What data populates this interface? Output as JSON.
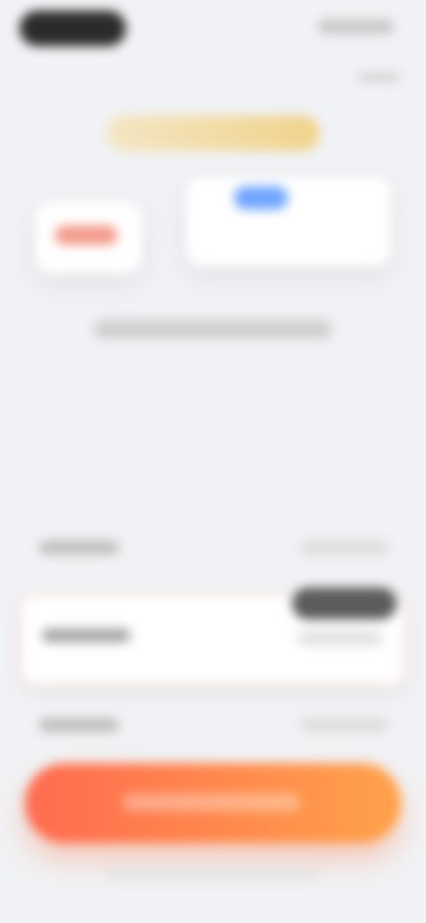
{
  "status": {
    "time": "",
    "icons": ""
  },
  "header": {
    "top_link": ""
  },
  "hero": {
    "badge_text": "",
    "card_primary_title": "",
    "card_secondary_title": ""
  },
  "subtitle": "",
  "headline": {
    "line1_prefix": "",
    "line1_accent": "",
    "line1_suffix": "",
    "line2": "",
    "line3_prefix": "",
    "line3_accent": ""
  },
  "plans": [
    {
      "label": "",
      "value": ""
    },
    {
      "label": "",
      "value": "",
      "badge": ""
    },
    {
      "label": "",
      "value": ""
    }
  ],
  "cta": {
    "label": ""
  },
  "footer": {
    "note": ""
  },
  "colors": {
    "accent_gradient_start": "#ff6b4f",
    "accent_gradient_end": "#ffa24a",
    "highlight_border": "#ffe0d9",
    "badge_bg": "#5b5b5b",
    "hero_badge_gold": "#f0d28b"
  }
}
